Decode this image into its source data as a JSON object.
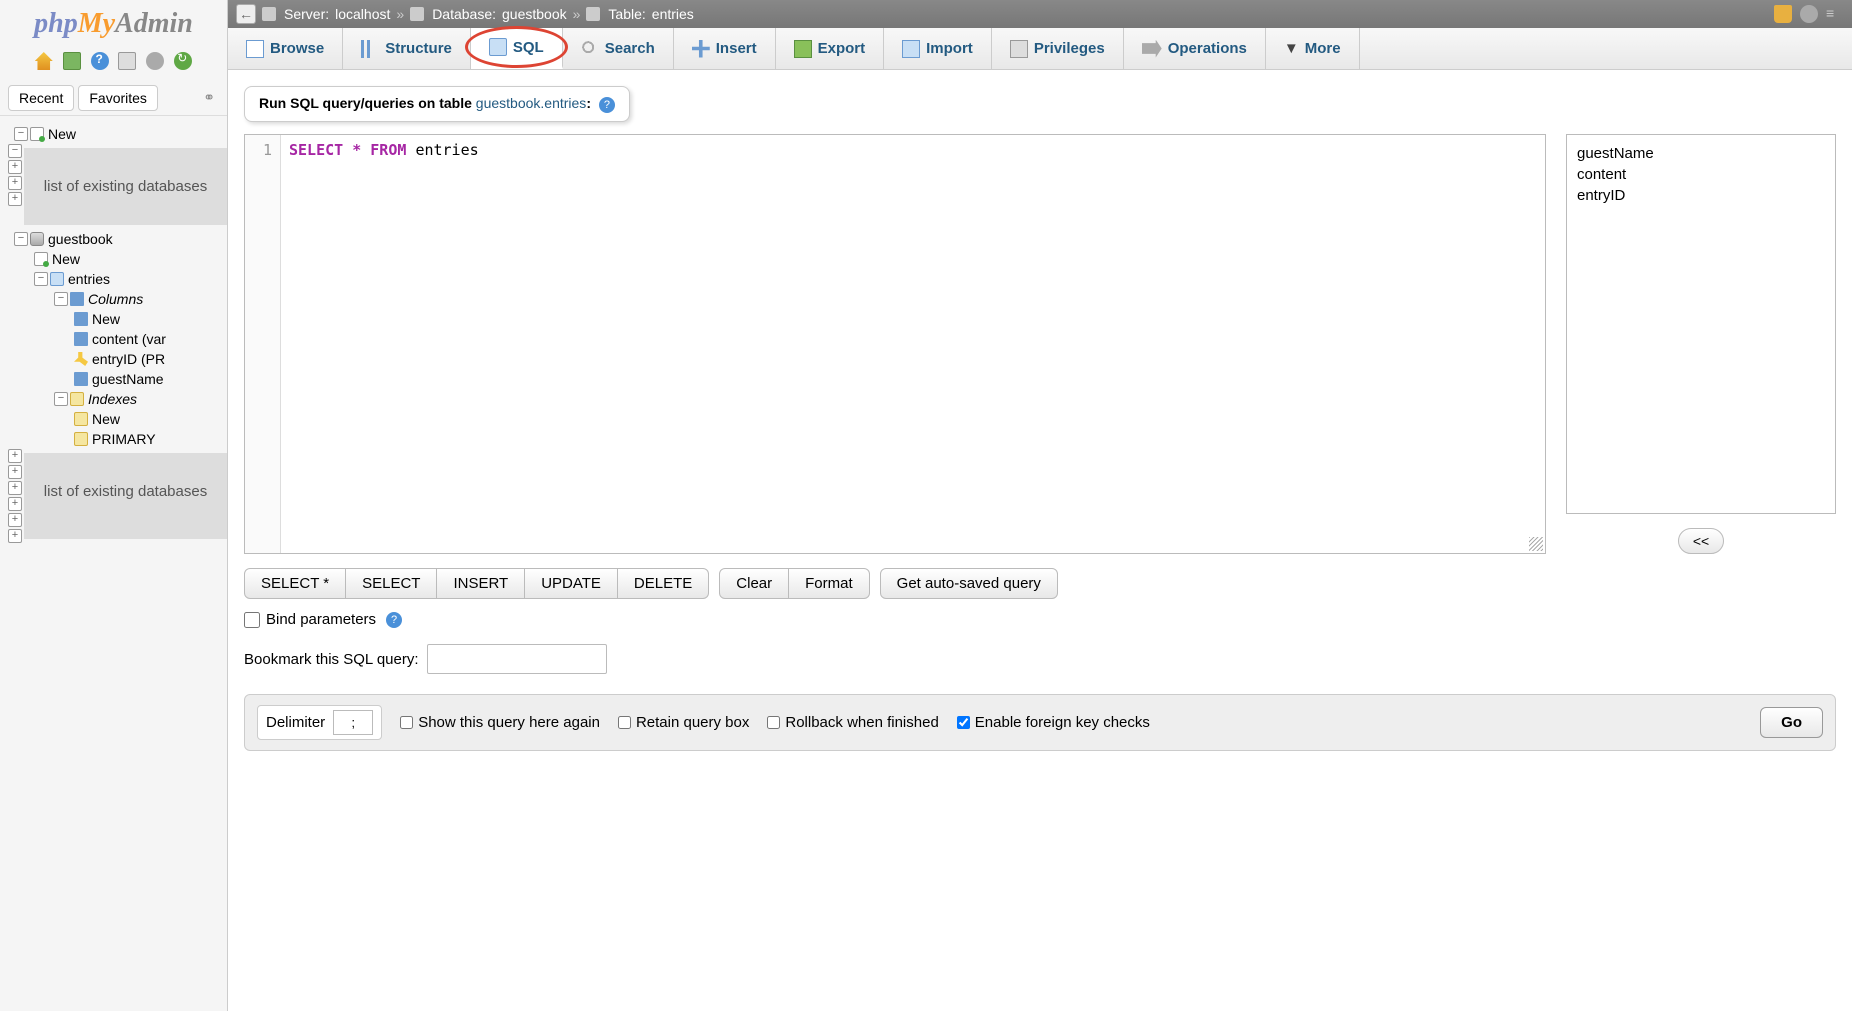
{
  "logo": {
    "php": "php",
    "my": "My",
    "admin": "Admin"
  },
  "sidebar": {
    "tabs": [
      "Recent",
      "Favorites"
    ],
    "new_label": "New",
    "placeholder": "list of existing databases",
    "db_name": "guestbook",
    "table_name": "entries",
    "columns_label": "Columns",
    "col_new": "New",
    "col_content": "content (var",
    "col_entryid": "entryID (PR",
    "col_guestname": "guestName",
    "indexes_label": "Indexes",
    "idx_new": "New",
    "idx_primary": "PRIMARY"
  },
  "breadcrumb": {
    "server_label": "Server:",
    "server_value": "localhost",
    "db_label": "Database:",
    "db_value": "guestbook",
    "table_label": "Table:",
    "table_value": "entries"
  },
  "tabs": {
    "browse": "Browse",
    "structure": "Structure",
    "sql": "SQL",
    "search": "Search",
    "insert": "Insert",
    "export": "Export",
    "import": "Import",
    "privileges": "Privileges",
    "operations": "Operations",
    "more": "More"
  },
  "panel": {
    "prefix": "Run SQL query/queries on table ",
    "link": "guestbook.entries",
    "suffix": ":"
  },
  "editor": {
    "line_number": "1",
    "code_select": "SELECT",
    "code_star": "*",
    "code_from": "FROM",
    "code_table": "entries"
  },
  "columns": [
    "guestName",
    "content",
    "entryID"
  ],
  "buttons": {
    "select_star": "SELECT *",
    "select": "SELECT",
    "insert": "INSERT",
    "update": "UPDATE",
    "delete": "DELETE",
    "clear": "Clear",
    "format": "Format",
    "autosaved": "Get auto-saved query",
    "collapse": "<<",
    "go": "Go"
  },
  "checkboxes": {
    "bind_params": "Bind parameters",
    "bookmark_label": "Bookmark this SQL query:",
    "delimiter_label": "Delimiter",
    "delimiter_value": ";",
    "show_again": "Show this query here again",
    "retain": "Retain query box",
    "rollback": "Rollback when finished",
    "fk": "Enable foreign key checks"
  }
}
